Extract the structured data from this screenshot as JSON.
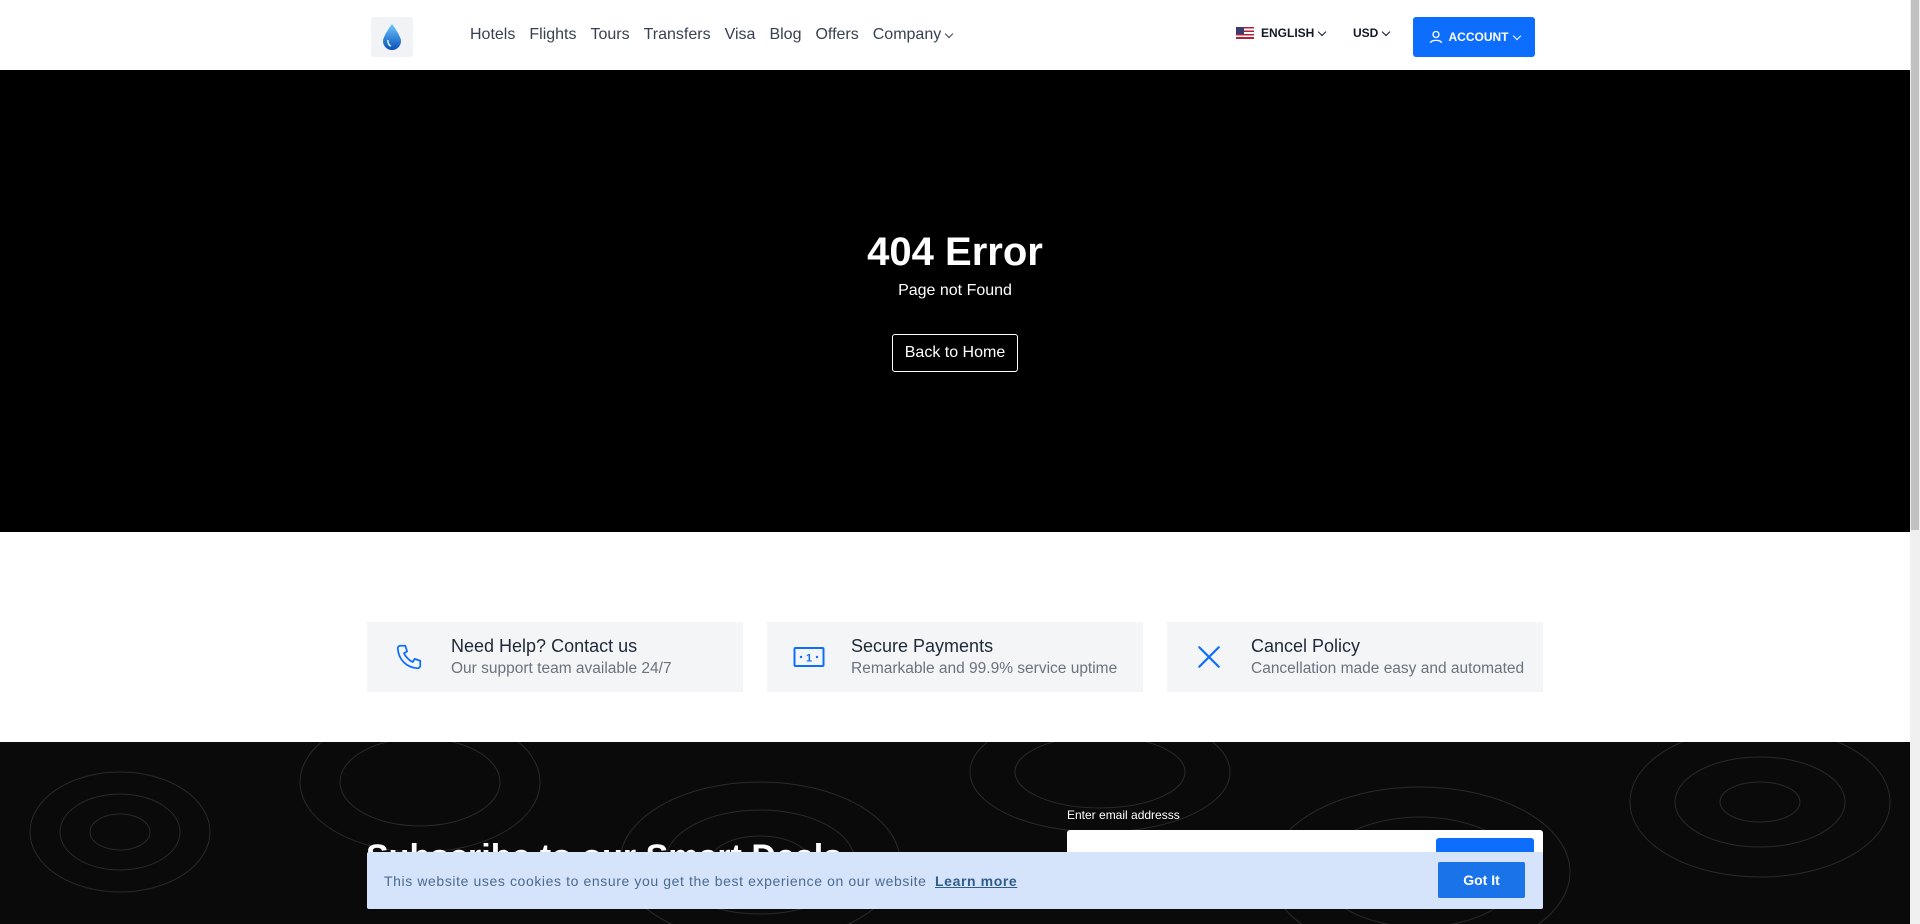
{
  "header": {
    "nav": [
      {
        "label": "Hotels"
      },
      {
        "label": "Flights"
      },
      {
        "label": "Tours"
      },
      {
        "label": "Transfers"
      },
      {
        "label": "Visa"
      },
      {
        "label": "Blog"
      },
      {
        "label": "Offers"
      },
      {
        "label": "Company"
      }
    ],
    "language": "ENGLISH",
    "currency": "USD",
    "account": "ACCOUNT"
  },
  "hero": {
    "title": "404 Error",
    "subtitle": "Page not Found",
    "button": "Back to Home"
  },
  "features": [
    {
      "icon": "phone-icon",
      "title": "Need Help? Contact us",
      "desc": "Our support team available 24/7"
    },
    {
      "icon": "money-icon",
      "title": "Secure Payments",
      "desc": "Remarkable and 99.9% service uptime"
    },
    {
      "icon": "close-icon",
      "title": "Cancel Policy",
      "desc": "Cancellation made easy and automated"
    }
  ],
  "subscribe": {
    "title": "Subscribe to our Smart Deals",
    "email_label": "Enter email addresss",
    "email_value": ""
  },
  "cookie": {
    "message": "This website uses cookies to ensure you get the best experience on our website",
    "link": "Learn more",
    "button": "Got It"
  },
  "colors": {
    "accent": "#0d6efd",
    "hero_bg": "#000000",
    "cookie_bg": "#d5e3fb"
  }
}
